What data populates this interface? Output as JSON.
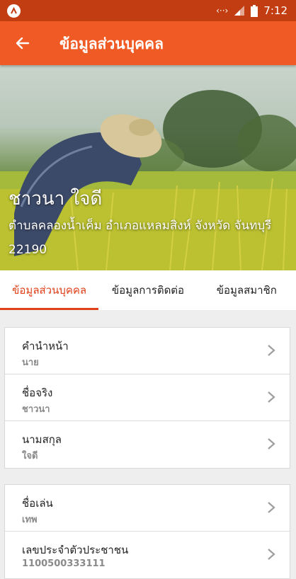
{
  "status": {
    "time": "7:12",
    "signal_text": "‹··›"
  },
  "header": {
    "title": "ข้อมูลส่วนบุคคล"
  },
  "profile": {
    "name": "ชาวนา ใจดี",
    "address": "ตำบลคลองน้ำเค็ม อำเภอแหลมสิงห์ จังหวัด จันทบุรี 22190"
  },
  "tabs": [
    {
      "label": "ข้อมูลส่วนบุคคล"
    },
    {
      "label": "ข้อมูลการติดต่อ"
    },
    {
      "label": "ข้อมูลสมาชิก"
    }
  ],
  "fields_group1": [
    {
      "label": "คำนำหน้า",
      "value": "นาย"
    },
    {
      "label": "ชื่อจริง",
      "value": "ชาวนา"
    },
    {
      "label": "นามสกุล",
      "value": "ใจดี"
    }
  ],
  "fields_group2": [
    {
      "label": "ชื่อเล่น",
      "value": "เทพ"
    },
    {
      "label": "เลขประจำตัวประชาชน",
      "value": "1100500333111"
    }
  ],
  "colors": {
    "statusbar": "#c33d12",
    "appbar": "#f05a24",
    "accent": "#e0401a"
  }
}
